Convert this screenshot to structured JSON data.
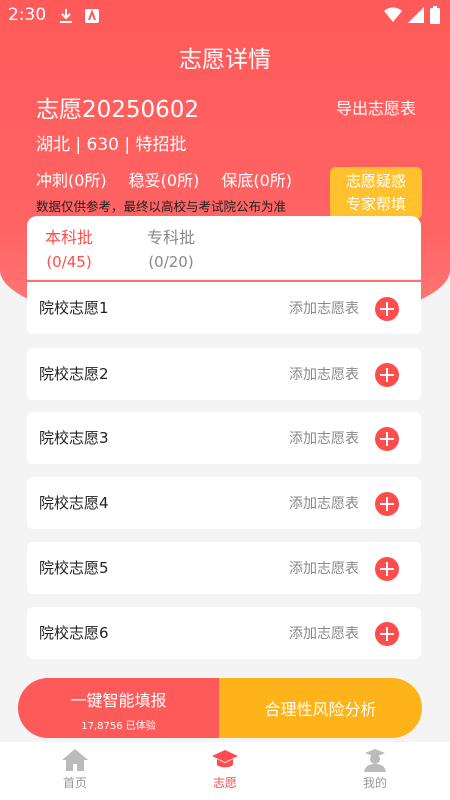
{
  "status": {
    "time": "2:30"
  },
  "header": {
    "title": "志愿详情",
    "export_label": "导出志愿表"
  },
  "plan": {
    "name": "志愿20250602",
    "meta": "湖北 | 630 | 特招批"
  },
  "counts": {
    "chongci": "冲刺(0所)",
    "wentuo": "稳妥(0所)",
    "baodi": "保底(0所)"
  },
  "disclaimer": "数据仅供参考，最终以高校与考试院公布为准",
  "expert": {
    "line1": "志愿疑惑",
    "line2": "专家帮填"
  },
  "tabs": [
    {
      "label": "本科批",
      "count": "(0/45)"
    },
    {
      "label": "专科批",
      "count": "(0/20)"
    }
  ],
  "rows": [
    {
      "label": "院校志愿1",
      "action": "添加志愿表"
    },
    {
      "label": "院校志愿2",
      "action": "添加志愿表"
    },
    {
      "label": "院校志愿3",
      "action": "添加志愿表"
    },
    {
      "label": "院校志愿4",
      "action": "添加志愿表"
    },
    {
      "label": "院校志愿5",
      "action": "添加志愿表"
    },
    {
      "label": "院校志愿6",
      "action": "添加志愿表"
    }
  ],
  "cta": {
    "primary": "一键智能填报",
    "primary_sub": "17,8756 已体验",
    "secondary": "合理性风险分析"
  },
  "nav": [
    {
      "label": "首页",
      "icon": "home-icon"
    },
    {
      "label": "志愿",
      "icon": "graduation-cap-icon"
    },
    {
      "label": "我的",
      "icon": "profile-icon"
    }
  ],
  "colors": {
    "primary": "#ff5a5a",
    "accent": "#ffb31a",
    "expert_badge": "#ffc12e"
  }
}
